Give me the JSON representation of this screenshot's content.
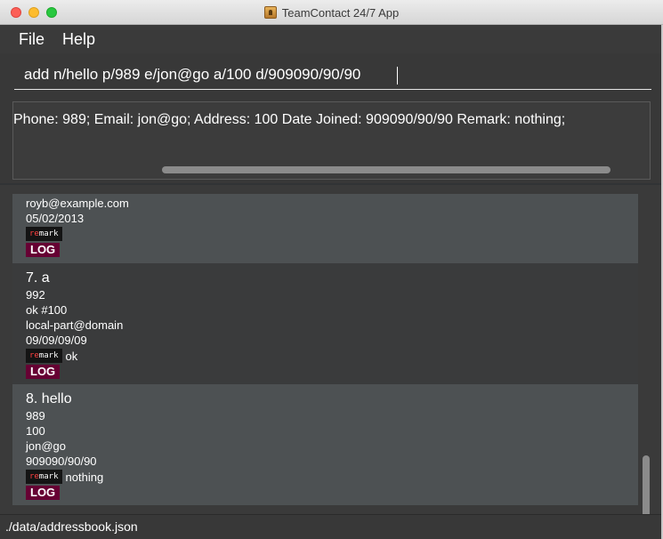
{
  "window": {
    "title": "TeamContact 24/7 App"
  },
  "menu": {
    "items": [
      "File",
      "Help"
    ]
  },
  "command": {
    "value": "add n/hello p/989 e/jon@go a/100 d/909090/90/90"
  },
  "result": {
    "text": "Phone: 989; Email: jon@go; Address: 100 Date Joined: 909090/90/90 Remark: nothing;"
  },
  "remark_tag": {
    "re": "re",
    "mark": "mark"
  },
  "persons": [
    {
      "email": "royb@example.com",
      "date": "05/02/2013",
      "remark": "",
      "log": "LOG"
    },
    {
      "header": "7.  a",
      "phone": "992",
      "address": "ok #100",
      "email": "local-part@domain",
      "date": "09/09/09/09",
      "remark": "ok",
      "log": "LOG"
    },
    {
      "header": "8.  hello",
      "phone": "989",
      "address": "100",
      "email": "jon@go",
      "date": "909090/90/90",
      "remark": "nothing",
      "log": "LOG"
    }
  ],
  "status": {
    "path": "./data/addressbook.json"
  },
  "colors": {
    "background": "#313335",
    "card_light": "#4d5153",
    "log_tag": "#660033",
    "remark_accent": "#ff4040"
  }
}
